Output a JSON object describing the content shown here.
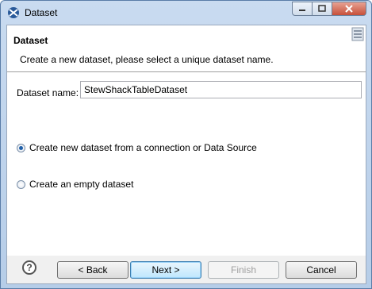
{
  "window": {
    "title": "Dataset"
  },
  "banner": {
    "title": "Dataset",
    "description": "Create a new dataset, please select a unique dataset name."
  },
  "form": {
    "name_label": "Dataset name:",
    "name_value": "StewShackTableDataset",
    "options": [
      {
        "label": "Create new dataset from a connection or Data Source",
        "selected": true
      },
      {
        "label": "Create an empty dataset",
        "selected": false
      }
    ]
  },
  "buttons": {
    "back": "< Back",
    "next": "Next >",
    "finish": "Finish",
    "cancel": "Cancel"
  },
  "help": {
    "glyph": "?"
  }
}
